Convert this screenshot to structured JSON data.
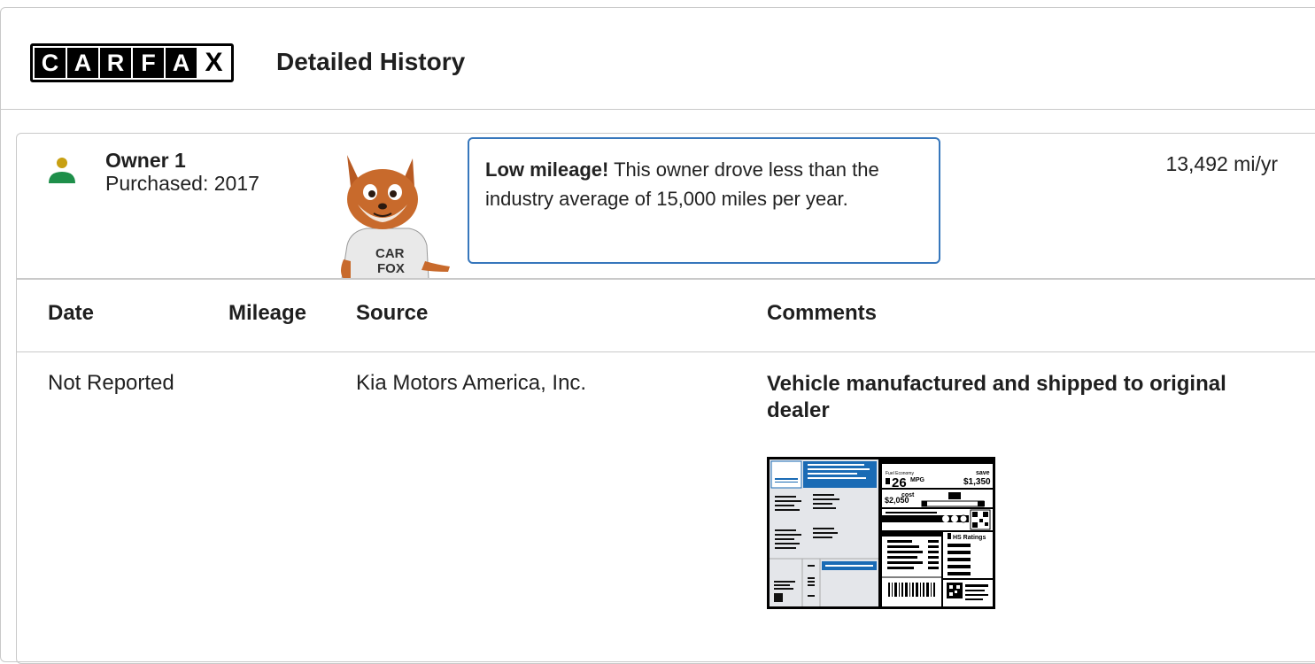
{
  "header": {
    "logo_letters": [
      "C",
      "A",
      "R",
      "F",
      "A",
      "X"
    ],
    "title": "Detailed History"
  },
  "owner": {
    "name": "Owner 1",
    "purchased": "Purchased: 2017",
    "mileage_rate": "13,492 mi/yr",
    "icon_colors": {
      "head": "#c8a012",
      "body": "#1e8f4a"
    }
  },
  "callout": {
    "bold": "Low mileage!",
    "text": " This owner drove less than the industry average of 15,000 miles per year."
  },
  "table": {
    "headers": [
      "Date",
      "Mileage",
      "Source",
      "Comments"
    ],
    "rows": [
      {
        "date": "Not Reported",
        "mileage": "",
        "source": "Kia Motors America, Inc.",
        "comment": "Vehicle manufactured and shipped to original dealer"
      }
    ]
  },
  "window_sticker": {
    "mpg": "26",
    "mpg_unit": "MPG",
    "save_label": "save",
    "save_amount": "$1,350",
    "annual_cost_label": "cost",
    "annual_cost": "$2,050",
    "ratings_label": "HS Ratings"
  },
  "colors": {
    "accent": "#3777bc",
    "border": "#c9c9c9",
    "sticker_blue": "#1a6bb5"
  }
}
